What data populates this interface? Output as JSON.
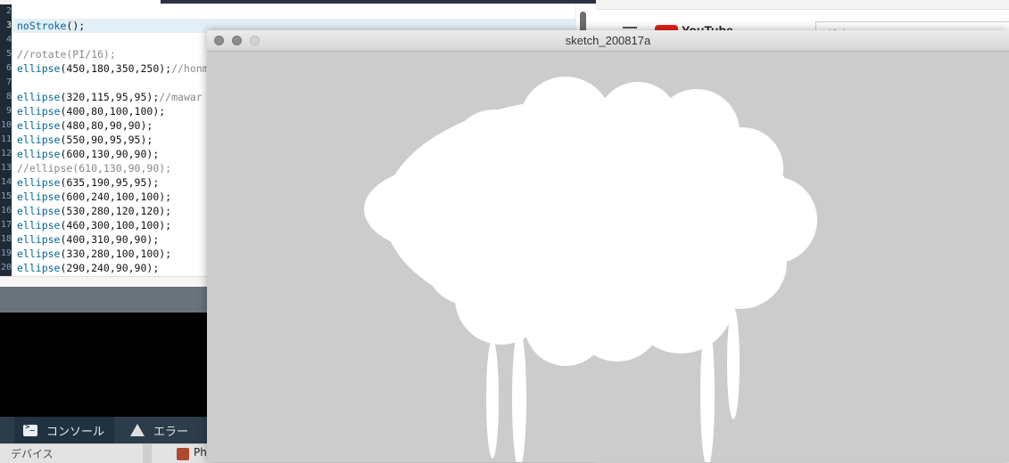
{
  "browser": {
    "search_placeholder": "検索",
    "logo_text": "YouTube"
  },
  "editor": {
    "lines": [
      {
        "num": "2",
        "text": "",
        "current": false
      },
      {
        "num": "3",
        "text": "noStroke();",
        "current": true
      },
      {
        "num": "4",
        "text": "",
        "current": false
      },
      {
        "num": "5",
        "text": "//rotate(PI/16);",
        "current": false
      },
      {
        "num": "6",
        "text": "ellipse(450,180,350,250);//honm",
        "current": false
      },
      {
        "num": "7",
        "text": "",
        "current": false
      },
      {
        "num": "8",
        "text": "ellipse(320,115,95,95);//mawar",
        "current": false
      },
      {
        "num": "9",
        "text": "ellipse(400,80,100,100);",
        "current": false
      },
      {
        "num": "10",
        "text": "ellipse(480,80,90,90);",
        "current": false
      },
      {
        "num": "11",
        "text": "ellipse(550,90,95,95);",
        "current": false
      },
      {
        "num": "12",
        "text": "ellipse(600,130,90,90);",
        "current": false
      },
      {
        "num": "13",
        "text": "//ellipse(610,130,90,90);",
        "current": false
      },
      {
        "num": "14",
        "text": "ellipse(635,190,95,95);",
        "current": false
      },
      {
        "num": "15",
        "text": "ellipse(600,240,100,100);",
        "current": false
      },
      {
        "num": "16",
        "text": "ellipse(530,280,120,120);",
        "current": false
      },
      {
        "num": "17",
        "text": "ellipse(460,300,100,100);",
        "current": false
      },
      {
        "num": "18",
        "text": "ellipse(400,310,90,90);",
        "current": false
      },
      {
        "num": "19",
        "text": "ellipse(330,280,100,100);",
        "current": false
      },
      {
        "num": "20",
        "text": "ellipse(290,240,90,90);",
        "current": false
      }
    ]
  },
  "footer": {
    "console_label": "コンソール",
    "error_label": "エラー"
  },
  "finder": {
    "devices_label": "デバイス",
    "app_label": "Ph"
  },
  "sketch": {
    "title": "sketch_200817a",
    "background_color": "#cccccc",
    "fill_color": "#ffffff"
  }
}
